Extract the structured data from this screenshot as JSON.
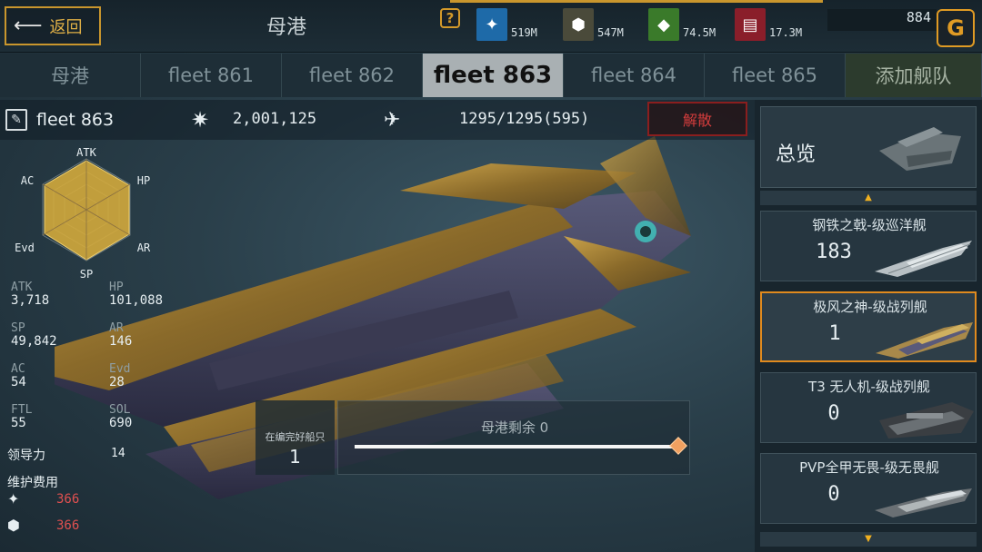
{
  "topbar": {
    "back_label": "返回",
    "title": "母港",
    "resources": [
      {
        "icon": "metal-icon",
        "value": "519M",
        "color": "#1e6aa8"
      },
      {
        "icon": "crystal-ore-icon",
        "value": "547M",
        "color": "#4a4a3a"
      },
      {
        "icon": "crystal-icon",
        "value": "74.5M",
        "color": "#3a7a2a"
      },
      {
        "icon": "supply-icon",
        "value": "17.3M",
        "color": "#8a1e2a"
      }
    ],
    "currency_value": "884"
  },
  "tabs": [
    {
      "label": "母港"
    },
    {
      "label": "fleet 861"
    },
    {
      "label": "fleet 862"
    },
    {
      "label": "fleet 863"
    },
    {
      "label": "fleet 864"
    },
    {
      "label": "fleet 865"
    },
    {
      "label": "添加舰队"
    }
  ],
  "active_tab_index": 3,
  "fleet": {
    "name": "fleet 863",
    "power": "2,001,125",
    "capacity": "1295/1295(595)",
    "disband_label": "解散"
  },
  "radar": {
    "labels": [
      "ATK",
      "HP",
      "AR",
      "SP",
      "Evd",
      "AC"
    ]
  },
  "stats": [
    {
      "key": "ATK",
      "value": "3,718"
    },
    {
      "key": "HP",
      "value": "101,088"
    },
    {
      "key": "SP",
      "value": "49,842"
    },
    {
      "key": "AR",
      "value": "146"
    },
    {
      "key": "AC",
      "value": "54"
    },
    {
      "key": "Evd",
      "value": "28"
    },
    {
      "key": "FTL",
      "value": "55"
    },
    {
      "key": "SOL",
      "value": "690"
    }
  ],
  "leadership": {
    "label": "领导力",
    "value": "14"
  },
  "maintenance": {
    "label": "维护费用",
    "items": [
      {
        "icon": "metal-icon",
        "value": "366"
      },
      {
        "icon": "crystal-ore-icon",
        "value": "366"
      }
    ]
  },
  "intact": {
    "label": "在编完好船只",
    "value": "1"
  },
  "remaining": {
    "label": "母港剩余 0",
    "fraction": 1.0
  },
  "sidebar": {
    "overview_label": "总览",
    "ships": [
      {
        "name": "钢铁之戟-级巡洋舰",
        "count": "183",
        "selected": false
      },
      {
        "name": "极风之神-级战列舰",
        "count": "1",
        "selected": true
      },
      {
        "name": "T3 无人机-级战列舰",
        "count": "0",
        "selected": false
      },
      {
        "name": "PVP全甲无畏-级无畏舰",
        "count": "0",
        "selected": false
      }
    ]
  }
}
